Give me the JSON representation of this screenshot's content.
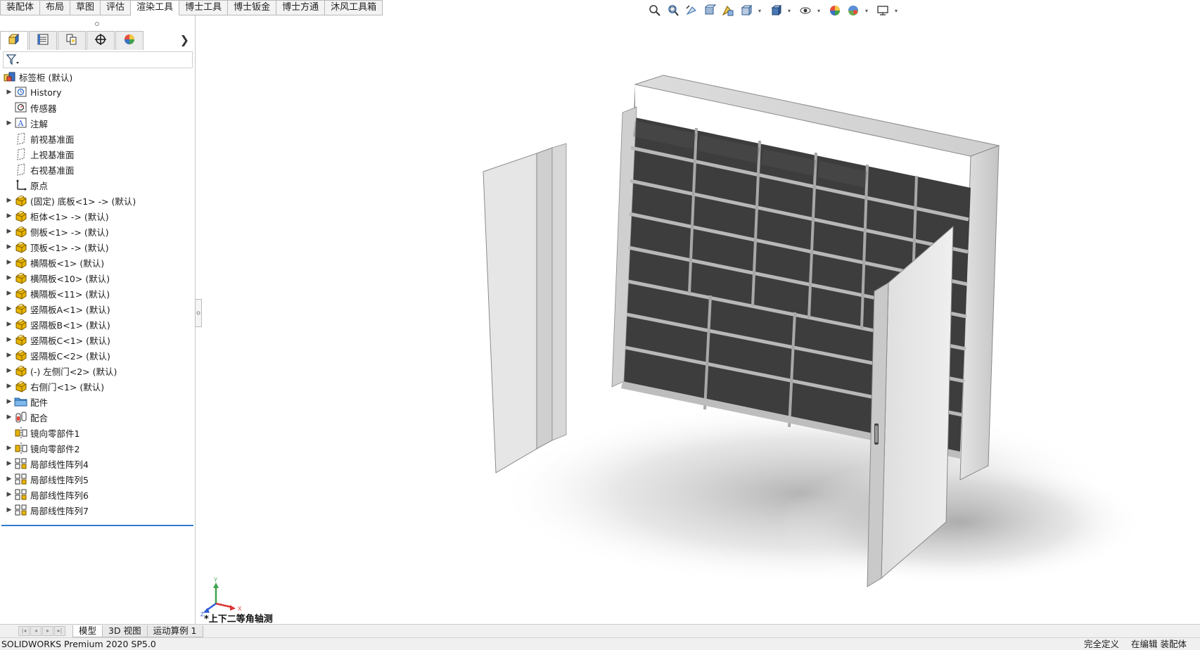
{
  "command_tabs": [
    "装配体",
    "布局",
    "草图",
    "评估",
    "渲染工具",
    "博士工具",
    "博士钣金",
    "博士方通",
    "沐风工具箱"
  ],
  "active_tab_index": 4,
  "hud_icons": [
    "zoom-to-fit-icon",
    "zoom-area-icon",
    "previous-view-icon",
    "section-view-icon",
    "dynamic-annotation-icon",
    "view-orientation-icon",
    "display-style-icon",
    "hide-show-items-icon",
    "edit-appearance-icon",
    "apply-scene-icon",
    "view-settings-icon"
  ],
  "panel_tabs": [
    "featuremanager-icon",
    "propertymanager-icon",
    "configurationmanager-icon",
    "dimxpert-icon",
    "displaymanager-icon"
  ],
  "tree": {
    "root": "标签柜  (默认)",
    "items": [
      {
        "label": "History",
        "icon": "history-icon",
        "expandable": true
      },
      {
        "label": "传感器",
        "icon": "sensor-icon",
        "expandable": false
      },
      {
        "label": "注解",
        "icon": "annotation-icon",
        "expandable": true
      },
      {
        "label": "前视基准面",
        "icon": "plane-icon",
        "expandable": false
      },
      {
        "label": "上视基准面",
        "icon": "plane-icon",
        "expandable": false
      },
      {
        "label": "右视基准面",
        "icon": "plane-icon",
        "expandable": false
      },
      {
        "label": "原点",
        "icon": "origin-icon",
        "expandable": false
      },
      {
        "label": "(固定) 底板<1> -> (默认)",
        "icon": "part-icon",
        "expandable": true
      },
      {
        "label": "柜体<1> -> (默认)",
        "icon": "part-icon",
        "expandable": true
      },
      {
        "label": "侧板<1> -> (默认)",
        "icon": "part-icon",
        "expandable": true
      },
      {
        "label": "顶板<1> -> (默认)",
        "icon": "part-icon",
        "expandable": true
      },
      {
        "label": "横隔板<1> (默认)",
        "icon": "part-icon",
        "expandable": true
      },
      {
        "label": "横隔板<10> (默认)",
        "icon": "part-icon",
        "expandable": true
      },
      {
        "label": "横隔板<11> (默认)",
        "icon": "part-icon",
        "expandable": true
      },
      {
        "label": "竖隔板A<1> (默认)",
        "icon": "part-icon",
        "expandable": true
      },
      {
        "label": "竖隔板B<1> (默认)",
        "icon": "part-icon",
        "expandable": true
      },
      {
        "label": "竖隔板C<1> (默认)",
        "icon": "part-icon",
        "expandable": true
      },
      {
        "label": "竖隔板C<2> (默认)",
        "icon": "part-icon",
        "expandable": true
      },
      {
        "label": "(-) 左侧门<2> (默认)",
        "icon": "part-icon",
        "expandable": true
      },
      {
        "label": "右侧门<1> (默认)",
        "icon": "part-icon",
        "expandable": true
      },
      {
        "label": "配件",
        "icon": "folder-icon",
        "expandable": true
      },
      {
        "label": "配合",
        "icon": "mates-icon",
        "expandable": true
      },
      {
        "label": "镜向零部件1",
        "icon": "mirror-component-icon",
        "expandable": false
      },
      {
        "label": "镜向零部件2",
        "icon": "mirror-component-icon",
        "expandable": true
      },
      {
        "label": "局部线性阵列4",
        "icon": "linear-pattern-icon",
        "expandable": true
      },
      {
        "label": "局部线性阵列5",
        "icon": "linear-pattern-icon",
        "expandable": true
      },
      {
        "label": "局部线性阵列6",
        "icon": "linear-pattern-icon",
        "expandable": true
      },
      {
        "label": "局部线性阵列7",
        "icon": "linear-pattern-icon",
        "expandable": true
      }
    ]
  },
  "triad": {
    "y": "Y",
    "x": "X",
    "z": "Z"
  },
  "view_label": "*上下二等角轴测",
  "bottom_tabs": [
    "模型",
    "3D 视图",
    "运动算例 1"
  ],
  "active_bottom_tab": 0,
  "status": {
    "product": "SOLIDWORKS Premium 2020 SP5.0",
    "definition": "完全定义",
    "mode": "在编辑 装配体"
  },
  "colors": {
    "accent": "#2e7bcf",
    "part_yellow": "#e8b400",
    "cabinet": "#d9d9d9"
  }
}
